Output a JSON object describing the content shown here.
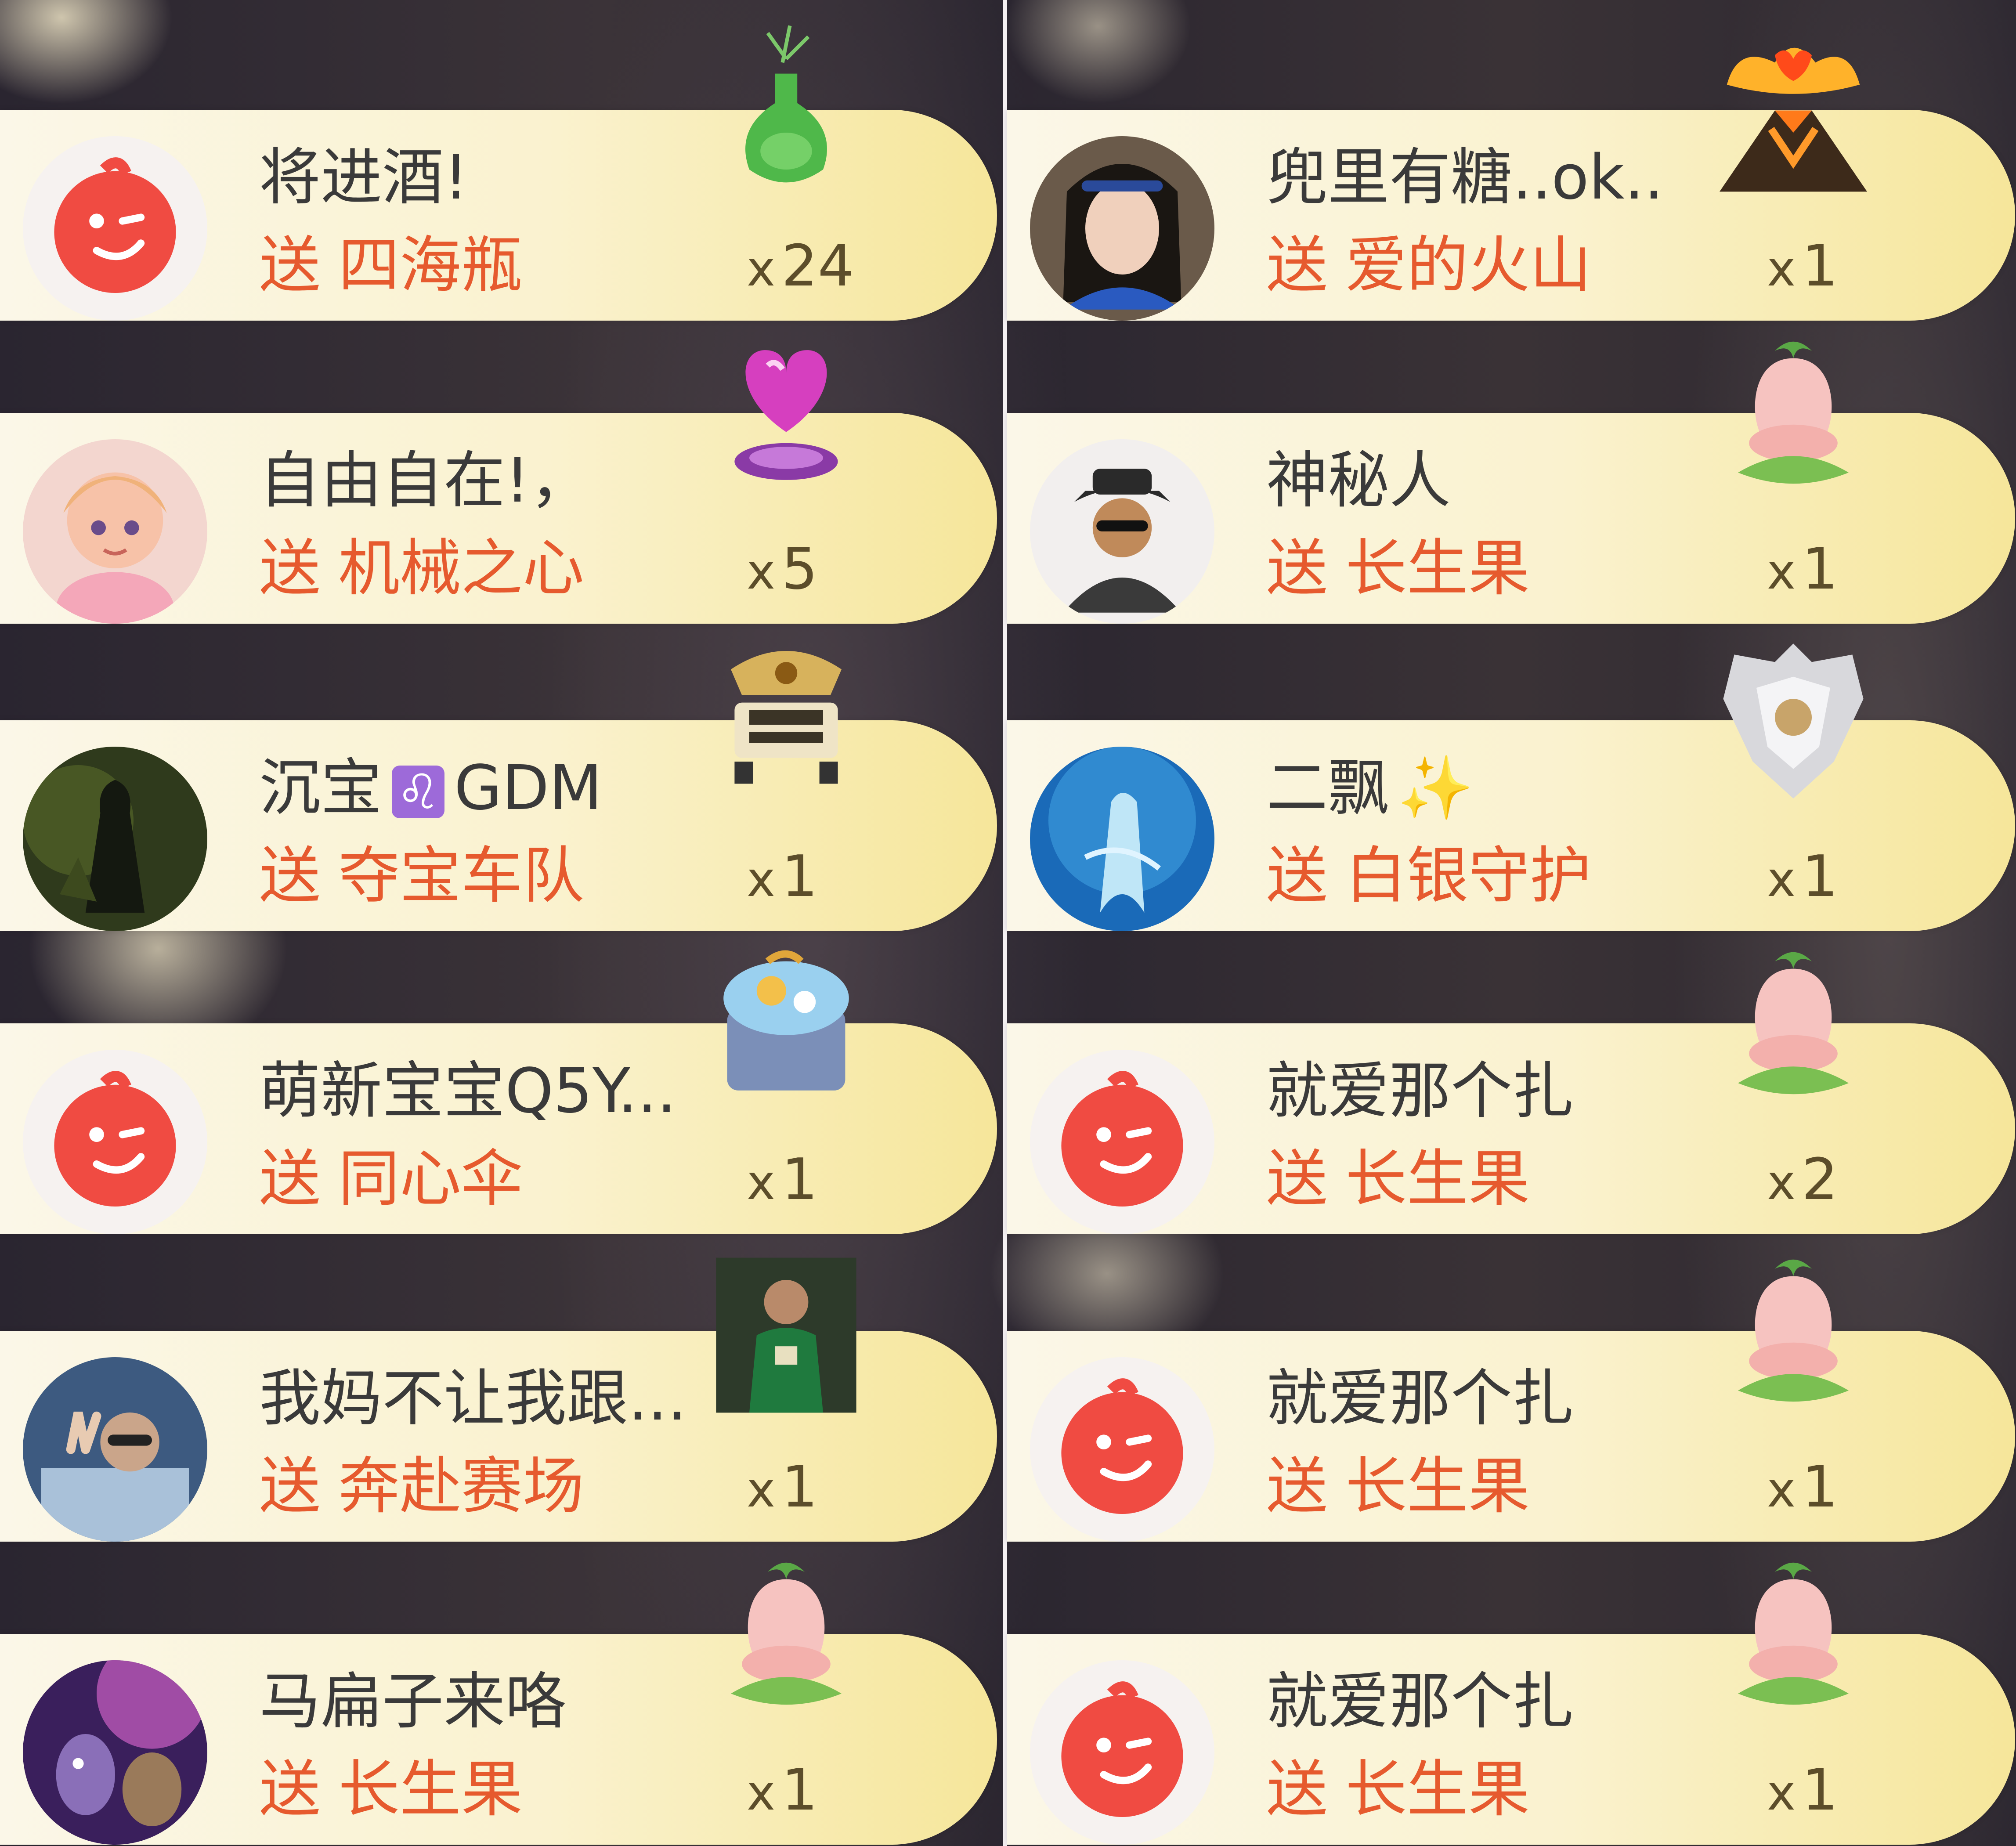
{
  "gift_label": "送",
  "count_prefix": "x",
  "colors": {
    "card_start": "#fbf7e8",
    "card_end": "#f6e69a",
    "gift_text": "#e65a2e",
    "name_text": "#3a3a3a",
    "default_avatar": "#f04b42",
    "zodiac_badge": "#9d6ad9"
  },
  "left_column": [
    {
      "name": "将进酒!",
      "gift": "四海瓶",
      "count": "24",
      "avatar_icon": "default-smiley-avatar",
      "gift_icon": "green-vase-icon"
    },
    {
      "name": "自由自在!，",
      "gift": "机械之心",
      "count": "5",
      "avatar_icon": "anime-girl-avatar",
      "gift_icon": "pink-heart-crystal-icon"
    },
    {
      "name_prefix": "沉宝",
      "name_badge": "♌",
      "name_suffix": "GDM",
      "gift": "夺宝车队",
      "count": "1",
      "avatar_icon": "dark-warrior-avatar",
      "gift_icon": "treasure-jeep-icon"
    },
    {
      "name": "萌新宝宝Q5Y...",
      "gift": "同心伞",
      "count": "1",
      "avatar_icon": "default-smiley-avatar",
      "gift_icon": "umbrella-island-icon"
    },
    {
      "name": "我妈不让我跟...",
      "gift": "奔赴赛场",
      "count": "1",
      "avatar_icon": "car-selfie-avatar",
      "gift_icon": "football-player-icon"
    },
    {
      "name": "马扁子来咯",
      "gift": "长生果",
      "count": "1",
      "avatar_icon": "purple-cartoon-avatar",
      "gift_icon": "longevity-fruit-icon"
    }
  ],
  "right_column": [
    {
      "name": "兜里有糖..ok..",
      "gift": "爱的火山",
      "count": "1",
      "avatar_icon": "woman-portrait-avatar",
      "gift_icon": "love-volcano-icon"
    },
    {
      "name": "神秘人",
      "gift": "长生果",
      "count": "1",
      "avatar_icon": "mystery-man-avatar",
      "gift_icon": "longevity-fruit-icon"
    },
    {
      "name": "二飘",
      "name_emoji": "✨",
      "gift": "白银守护",
      "count": "1",
      "avatar_icon": "blue-spirit-avatar",
      "gift_icon": "silver-shield-icon"
    },
    {
      "name": "就爱那个扎",
      "gift": "长生果",
      "count": "2",
      "avatar_icon": "default-smiley-avatar",
      "gift_icon": "longevity-fruit-icon"
    },
    {
      "name": "就爱那个扎",
      "gift": "长生果",
      "count": "1",
      "avatar_icon": "default-smiley-avatar",
      "gift_icon": "longevity-fruit-icon"
    },
    {
      "name": "就爱那个扎",
      "gift": "长生果",
      "count": "1",
      "avatar_icon": "default-smiley-avatar",
      "gift_icon": "longevity-fruit-icon"
    }
  ]
}
